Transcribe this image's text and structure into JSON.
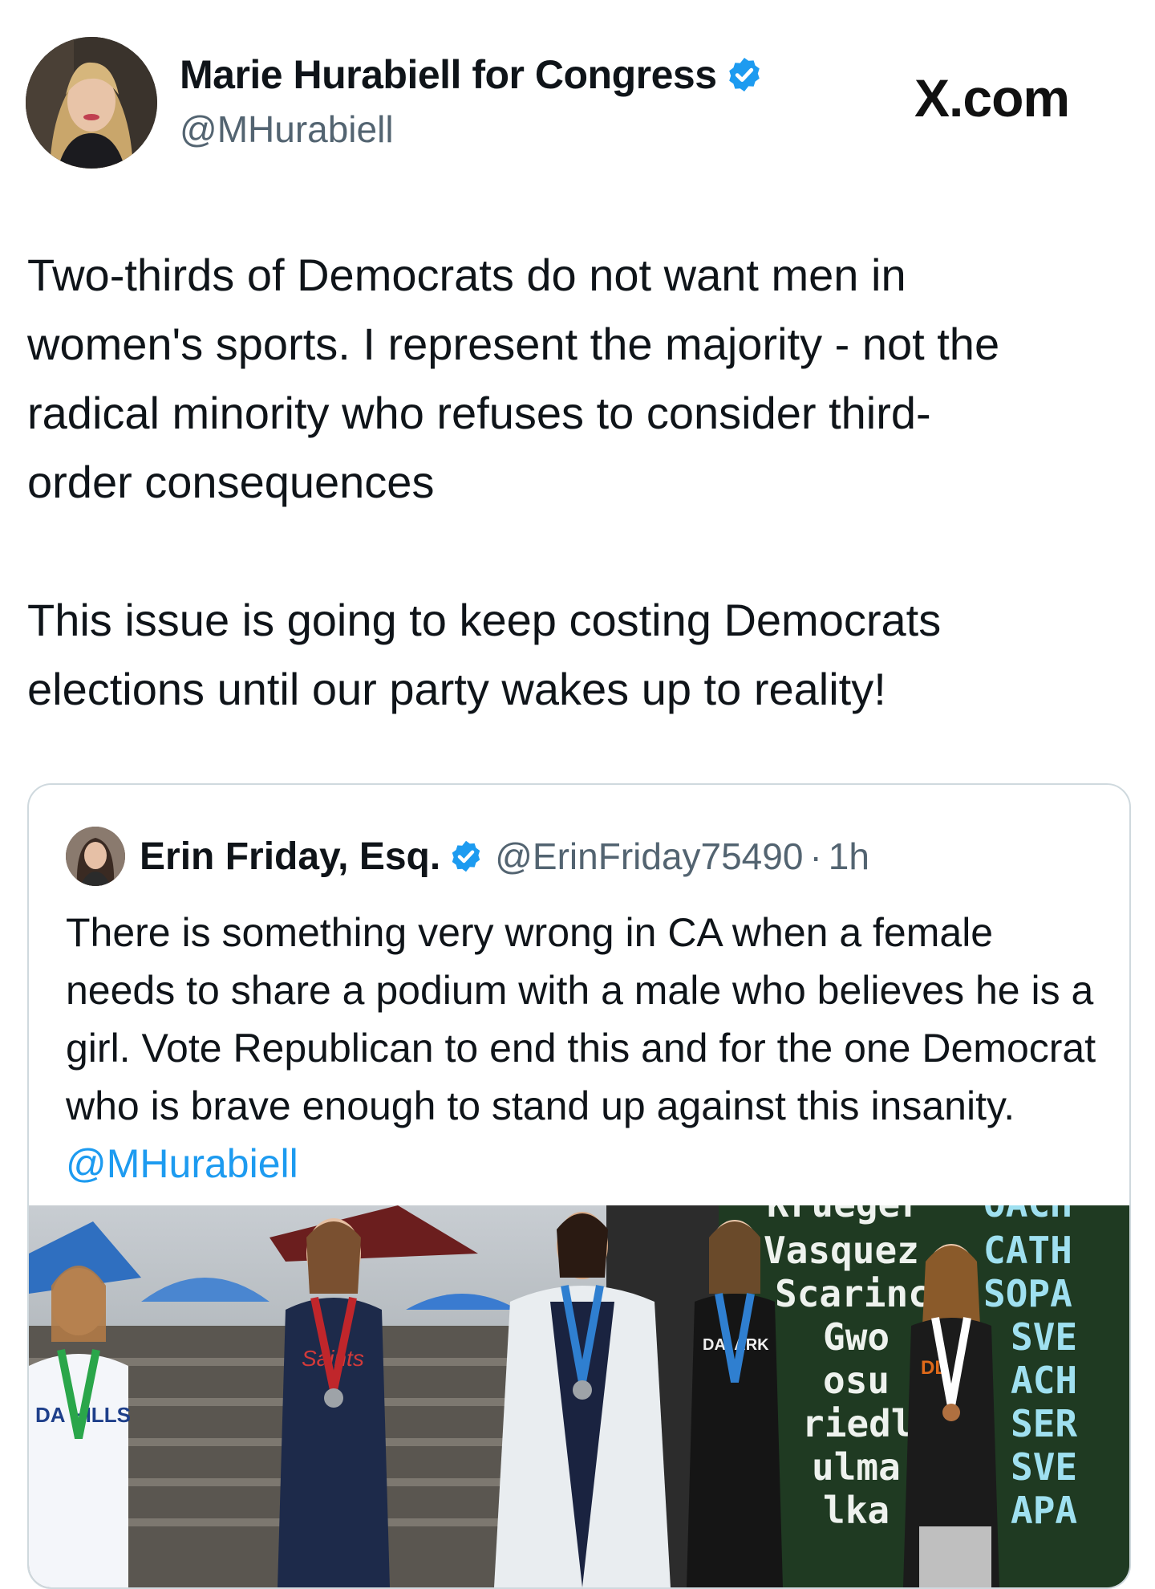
{
  "author": {
    "display_name": "Marie Hurabiell for Congress",
    "handle": "@MHurabiell",
    "avatar_icon": "profile-photo-avatar",
    "verified_icon": "verified-badge-icon"
  },
  "brand": "X.com",
  "tweet_text": "Two-thirds of Democrats do not want men in\nwomen's sports. I represent the majority - not the\nradical minority who refuses to consider third-\norder consequences\n\nThis issue is going to keep costing Democrats\nelections until our party wakes up to reality!",
  "quoted": {
    "display_name": "Erin Friday, Esq.",
    "handle": "@ErinFriday75490",
    "separator": "·",
    "time": "1h",
    "text": "There is something very wrong in CA when a female needs to share a podium with a male who believes he is a girl.  Vote Republican to end this and for the one Democrat who is brave enough to stand up against this insanity. ",
    "mention": "@MHurabiell",
    "photo": {
      "board_names": [
        "Krueger",
        "Vasquez",
        "Scarince",
        "Gwo",
        "osu",
        "riedl",
        "ulma",
        "lka"
      ],
      "board_schools": [
        "OACH",
        "CATH",
        "SOPA",
        "SVE",
        "ACH",
        "SER",
        "SVE",
        "APA"
      ],
      "jersey_labels": [
        "DA HILLS",
        "Saints",
        "DAI ARK",
        "DL"
      ]
    }
  },
  "colors": {
    "link": "#1d9bf0",
    "verified": "#1d9bf0",
    "muted": "#536471",
    "border": "#cfd9de"
  }
}
